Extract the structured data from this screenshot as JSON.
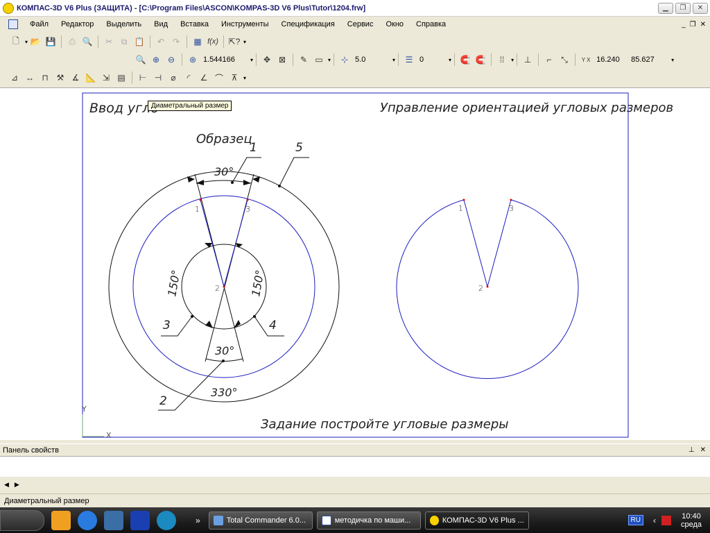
{
  "window": {
    "title": "КОМПАС-3D V6 Plus (ЗАЩИТА) - [C:\\Program Files\\ASCON\\KOMPAS-3D V6 Plus\\Tutor\\1204.frw]"
  },
  "menu": [
    "Файл",
    "Редактор",
    "Выделить",
    "Вид",
    "Вставка",
    "Инструменты",
    "Спецификация",
    "Сервис",
    "Окно",
    "Справка"
  ],
  "toolbar": {
    "zoom_value": "1.544166",
    "step_value": "5.0",
    "layer_value": "0",
    "coord_label": "Y X",
    "coord_x": "16.240",
    "coord_y": "85.627"
  },
  "tooltip": "Диаметральный размер",
  "drawing": {
    "title_left": "Ввод угло",
    "title_right": "Управление ориентацией угловых размеров",
    "sample": "Образец",
    "task": "Задание  постройте угловые размеры",
    "dim_30_top": "30°",
    "dim_30_bottom": "30°",
    "dim_150_left": "150°",
    "dim_150_right": "150°",
    "dim_330": "330°",
    "leader_1": "1",
    "leader_2": "2",
    "leader_3": "3",
    "leader_4": "4",
    "leader_5": "5",
    "pt_1": "1",
    "pt_2": "2",
    "pt_3": "3",
    "pt_r1": "1",
    "pt_r2": "2",
    "pt_r3": "3",
    "axis_y": "Y",
    "axis_x": "X"
  },
  "properties_panel": {
    "title": "Панель свойств"
  },
  "status": {
    "text": "Диаметральный размер"
  },
  "taskbar": {
    "tasks": [
      "Total Commander 6.0...",
      "методичка по маши...",
      "КОМПАС-3D V6 Plus ..."
    ],
    "lang": "RU",
    "time": "10:40",
    "day": "среда"
  }
}
